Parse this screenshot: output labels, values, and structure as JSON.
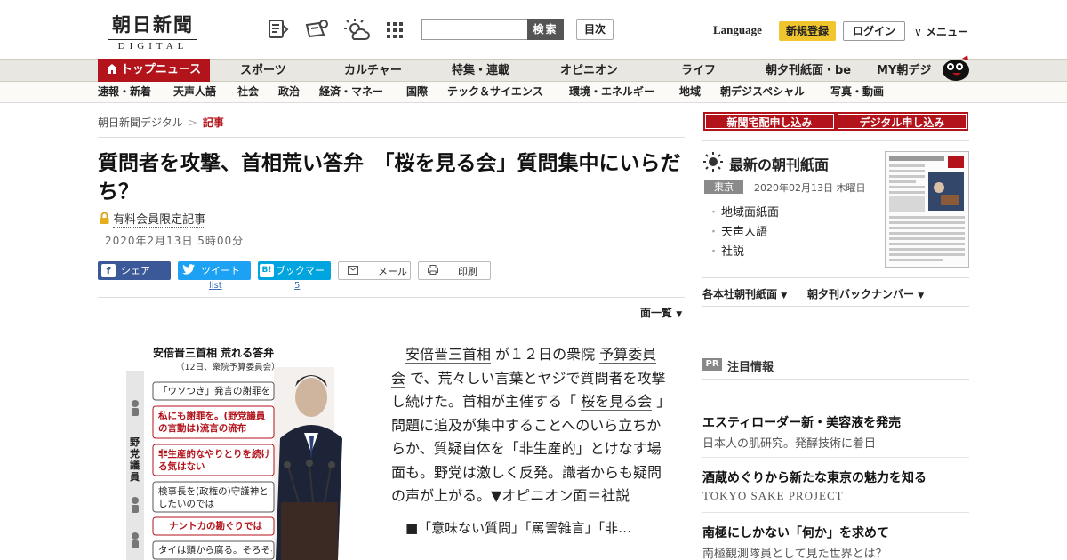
{
  "header": {
    "logo_main": "朝日新聞",
    "logo_sub": "DIGITAL",
    "search_button": "検索",
    "toc_button": "目次",
    "language": "Language",
    "signup": "新規登録",
    "login": "ログイン",
    "menu": "メニュー"
  },
  "nav_primary": [
    {
      "label": "トップニュース"
    },
    {
      "label": "スポーツ"
    },
    {
      "label": "カルチャー"
    },
    {
      "label": "特集・連載"
    },
    {
      "label": "オピニオン"
    },
    {
      "label": "ライフ"
    },
    {
      "label": "朝夕刊紙面・be"
    },
    {
      "label": "MY朝デジ"
    }
  ],
  "nav_secondary": [
    {
      "label": "速報・新着"
    },
    {
      "label": "天声人語"
    },
    {
      "label": "社会"
    },
    {
      "label": "政治"
    },
    {
      "label": "経済・マネー"
    },
    {
      "label": "国際"
    },
    {
      "label": "テック＆サイエンス"
    },
    {
      "label": "環境・エネルギー"
    },
    {
      "label": "地域"
    },
    {
      "label": "朝デジスペシャル"
    },
    {
      "label": "写真・動画"
    }
  ],
  "breadcrumb": {
    "home": "朝日新聞デジタル",
    "sep": ">",
    "current": "記事"
  },
  "article": {
    "title": "質問者を攻撃、首相荒い答弁　「桜を見る会」質問集中にいらだち？",
    "paid_label": "有料会員限定記事",
    "date": "2020年2月13日 5時00分",
    "share": {
      "facebook": "シェア",
      "twitter": "ツイート",
      "hatena": "ブックマーク",
      "hatena_icon": "B!",
      "mail": "メール",
      "print": "印刷"
    },
    "twitter_count": "list",
    "hatena_count": "5",
    "men_list": "面一覧",
    "body_parts": [
      "安倍晋三首相",
      " が１２日の衆院 ",
      "予算委員会",
      " で、荒々しい言葉とヤジで質問者を攻撃し続けた。首相が主催する「 ",
      "桜を見る会",
      " 」問題に追及が集中することへのいら立ちからか、質疑自体を「非生産的」とけなす場面も。野党は激しく反発。識者からも疑問の声が上がる。▼オピニオン面＝社説"
    ],
    "lead_link": "■「意味ない質問」「罵詈雑言」「非…"
  },
  "figure": {
    "title": "安倍晋三首相 荒れる答弁",
    "subtitle": "（12日、衆院予算委員会）",
    "side_label": "野党議員",
    "bubbles": [
      {
        "text": "「ウソつき」発言の謝罪を",
        "kind": "plain"
      },
      {
        "text": "私にも謝罪を。(野党議員の言動は)流言の流布",
        "kind": "red"
      },
      {
        "text": "非生産的なやりとりを続ける気はない",
        "kind": "red"
      },
      {
        "text": "検事長を(政権の)守護神としたいのでは",
        "kind": "plain"
      },
      {
        "text": "ナントカの勘ぐりでは",
        "kind": "red"
      },
      {
        "text": "タイは頭から腐る。そろそろ",
        "kind": "plain"
      }
    ]
  },
  "sidebar": {
    "btn_home": "新聞宅配申し込み",
    "btn_digital": "デジタル申し込み",
    "choukan_title": "最新の朝刊紙面",
    "edition": "東京",
    "paper_date": "2020年02月13日 木曜日",
    "links": [
      "地域面紙面",
      "天声人語",
      "社説"
    ],
    "back1": "各本社朝刊紙面",
    "back2": "朝夕刊バックナンバー",
    "pr_badge": "PR",
    "pr_label": "注目情報",
    "ads": [
      {
        "title": "エスティローダー新・美容液を発売",
        "sub": "日本人の肌研究。発酵技術に着目"
      },
      {
        "title": "酒蔵めぐりから新たな東京の魅力を知る",
        "sub": "TOKYO SAKE PROJECT"
      },
      {
        "title": "南極にしかない「何か」を求めて",
        "sub": "南極観測隊員として見た世界とは？"
      }
    ]
  },
  "colors": {
    "brand_red": "#b3131b",
    "signup_yellow": "#f0c52e",
    "facebook": "#3b5998",
    "twitter": "#1da1f2",
    "hatena": "#00a4de"
  }
}
